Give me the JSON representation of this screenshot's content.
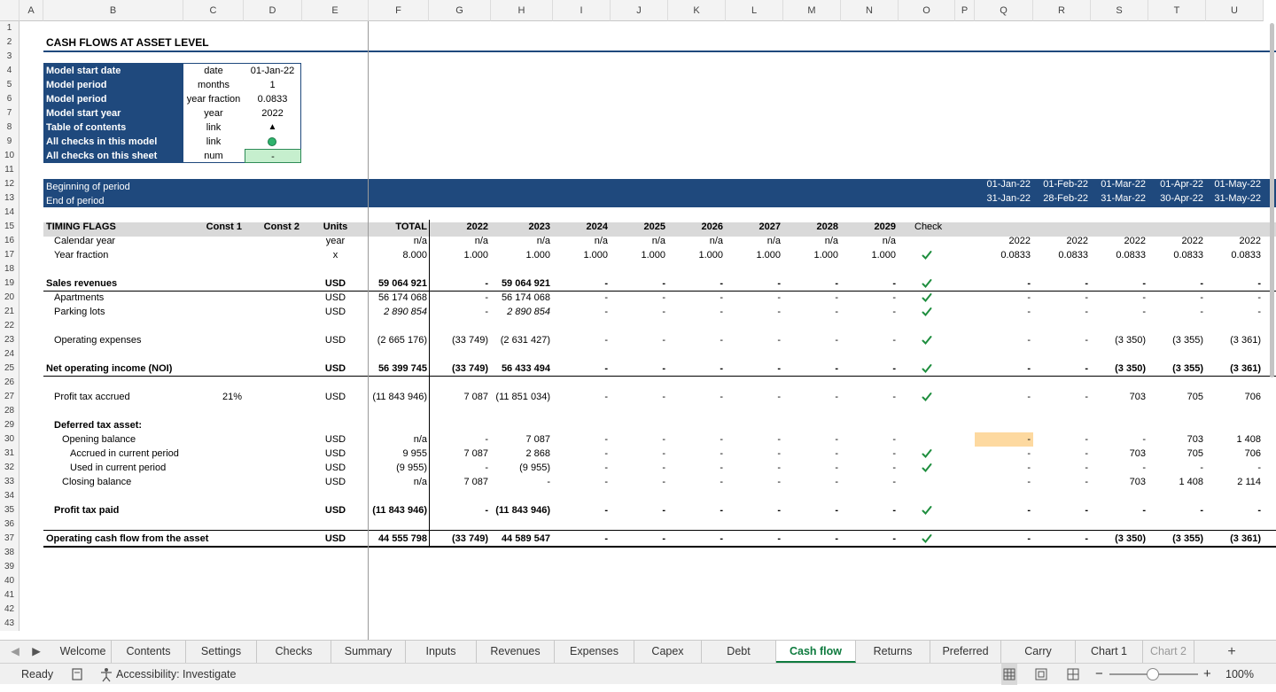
{
  "columns": [
    "A",
    "B",
    "C",
    "D",
    "E",
    "F",
    "G",
    "H",
    "I",
    "J",
    "K",
    "L",
    "M",
    "N",
    "O",
    "P",
    "Q",
    "R",
    "S",
    "T",
    "U"
  ],
  "rows": [
    "1",
    "2",
    "3",
    "4",
    "5",
    "6",
    "7",
    "8",
    "9",
    "10",
    "11",
    "12",
    "13",
    "14",
    "15",
    "16",
    "17",
    "18",
    "19",
    "20",
    "21",
    "22",
    "23",
    "24",
    "25",
    "26",
    "27",
    "28",
    "29",
    "30",
    "31",
    "32",
    "33",
    "34",
    "35",
    "36",
    "37",
    "38",
    "39",
    "40",
    "41",
    "42",
    "43"
  ],
  "title": "CASH FLOWS AT ASSET LEVEL",
  "info": [
    {
      "label": "Model start date",
      "unit": "date",
      "value": "01-Jan-22"
    },
    {
      "label": "Model period",
      "unit": "months",
      "value": "1"
    },
    {
      "label": "Model period",
      "unit": "year fraction",
      "value": "0.0833"
    },
    {
      "label": "Model start year",
      "unit": "year",
      "value": "2022"
    },
    {
      "label": "Table of contents",
      "unit": "link",
      "value": "▲"
    },
    {
      "label": "All checks in this model",
      "unit": "link",
      "value": ""
    },
    {
      "label": "All checks on this sheet",
      "unit": "num",
      "value": "-"
    }
  ],
  "period": {
    "begin_label": "Beginning of period",
    "end_label": "End of period",
    "begin": [
      "01-Jan-22",
      "01-Feb-22",
      "01-Mar-22",
      "01-Apr-22",
      "01-May-22"
    ],
    "end": [
      "31-Jan-22",
      "28-Feb-22",
      "31-Mar-22",
      "30-Apr-22",
      "31-May-22"
    ]
  },
  "header": {
    "label": "TIMING FLAGS",
    "const1": "Const 1",
    "const2": "Const 2",
    "units": "Units",
    "total": "TOTAL",
    "years": [
      "2022",
      "2023",
      "2024",
      "2025",
      "2026",
      "2027",
      "2028",
      "2029"
    ],
    "check": "Check"
  },
  "table_rows": [
    {
      "row": 16,
      "label": "Calendar year",
      "indent": 1,
      "const1": "",
      "unit": "year",
      "total": "n/a",
      "years": [
        "n/a",
        "n/a",
        "n/a",
        "n/a",
        "n/a",
        "n/a",
        "n/a",
        "n/a"
      ],
      "check": false,
      "monthly": [
        "2022",
        "2022",
        "2022",
        "2022",
        "2022"
      ]
    },
    {
      "row": 17,
      "label": "Year fraction",
      "indent": 1,
      "const1": "",
      "unit": "x",
      "total": "8.000",
      "years": [
        "1.000",
        "1.000",
        "1.000",
        "1.000",
        "1.000",
        "1.000",
        "1.000",
        "1.000"
      ],
      "check": true,
      "monthly": [
        "0.0833",
        "0.0833",
        "0.0833",
        "0.0833",
        "0.0833"
      ]
    },
    {
      "row": 19,
      "label": "Sales revenues",
      "indent": 0,
      "bold": true,
      "underline": true,
      "const1": "",
      "unit": "USD",
      "total": "59 064 921",
      "years": [
        "-",
        "59 064 921",
        "-",
        "-",
        "-",
        "-",
        "-",
        "-"
      ],
      "check": true,
      "monthly": [
        "-",
        "-",
        "-",
        "-",
        "-"
      ]
    },
    {
      "row": 20,
      "label": "Apartments",
      "indent": 1,
      "const1": "",
      "unit": "USD",
      "total": "56 174 068",
      "years": [
        "-",
        "56 174 068",
        "-",
        "-",
        "-",
        "-",
        "-",
        "-"
      ],
      "check": true,
      "monthly": [
        "-",
        "-",
        "-",
        "-",
        "-"
      ]
    },
    {
      "row": 21,
      "label": "Parking lots",
      "indent": 1,
      "italicvals": true,
      "const1": "",
      "unit": "USD",
      "total": "2 890 854",
      "years": [
        "-",
        "2 890 854",
        "-",
        "-",
        "-",
        "-",
        "-",
        "-"
      ],
      "check": true,
      "monthly": [
        "-",
        "-",
        "-",
        "-",
        "-"
      ]
    },
    {
      "row": 23,
      "label": "Operating expenses",
      "indent": 1,
      "const1": "",
      "unit": "USD",
      "total": "(2 665 176)",
      "years": [
        "(33 749)",
        "(2 631 427)",
        "-",
        "-",
        "-",
        "-",
        "-",
        "-"
      ],
      "check": true,
      "monthly": [
        "-",
        "-",
        "(3 350)",
        "(3 355)",
        "(3 361)"
      ]
    },
    {
      "row": 25,
      "label": "Net operating income (NOI)",
      "indent": 0,
      "bold": true,
      "underline": true,
      "const1": "",
      "unit": "USD",
      "total": "56 399 745",
      "years": [
        "(33 749)",
        "56 433 494",
        "-",
        "-",
        "-",
        "-",
        "-",
        "-"
      ],
      "check": true,
      "monthly": [
        "-",
        "-",
        "(3 350)",
        "(3 355)",
        "(3 361)"
      ]
    },
    {
      "row": 27,
      "label": "Profit tax accrued",
      "indent": 1,
      "const1": "21%",
      "unit": "USD",
      "total": "(11 843 946)",
      "years": [
        "7 087",
        "(11 851 034)",
        "-",
        "-",
        "-",
        "-",
        "-",
        "-"
      ],
      "check": true,
      "monthly": [
        "-",
        "-",
        "703",
        "705",
        "706"
      ]
    },
    {
      "row": 29,
      "label": "Deferred tax asset:",
      "indent": 1,
      "bold": true,
      "const1": "",
      "unit": "",
      "total": "",
      "years": [
        "",
        "",
        "",
        "",
        "",
        "",
        "",
        ""
      ],
      "check": false,
      "monthly": [
        "",
        "",
        "",
        "",
        ""
      ]
    },
    {
      "row": 30,
      "label": "Opening balance",
      "indent": 2,
      "const1": "",
      "unit": "USD",
      "total": "n/a",
      "years": [
        "-",
        "7 087",
        "-",
        "-",
        "-",
        "-",
        "-",
        "-"
      ],
      "check": false,
      "monthly": [
        "-",
        "-",
        "-",
        "703",
        "1 408"
      ]
    },
    {
      "row": 31,
      "label": "Accrued in current period",
      "indent": 3,
      "const1": "",
      "unit": "USD",
      "total": "9 955",
      "years": [
        "7 087",
        "2 868",
        "-",
        "-",
        "-",
        "-",
        "-",
        "-"
      ],
      "check": true,
      "monthly": [
        "-",
        "-",
        "703",
        "705",
        "706"
      ]
    },
    {
      "row": 32,
      "label": "Used in current period",
      "indent": 3,
      "const1": "",
      "unit": "USD",
      "total": "(9 955)",
      "years": [
        "-",
        "(9 955)",
        "-",
        "-",
        "-",
        "-",
        "-",
        "-"
      ],
      "check": true,
      "monthly": [
        "-",
        "-",
        "-",
        "-",
        "-"
      ]
    },
    {
      "row": 33,
      "label": "Closing balance",
      "indent": 2,
      "const1": "",
      "unit": "USD",
      "total": "n/a",
      "years": [
        "7 087",
        "-",
        "-",
        "-",
        "-",
        "-",
        "-",
        "-"
      ],
      "check": false,
      "monthly": [
        "-",
        "-",
        "703",
        "1 408",
        "2 114"
      ]
    },
    {
      "row": 35,
      "label": "Profit tax paid",
      "indent": 1,
      "bold": true,
      "const1": "",
      "unit": "USD",
      "total": "(11 843 946)",
      "years": [
        "-",
        "(11 843 946)",
        "-",
        "-",
        "-",
        "-",
        "-",
        "-"
      ],
      "check": true,
      "monthly": [
        "-",
        "-",
        "-",
        "-",
        "-"
      ]
    },
    {
      "row": 37,
      "label": "Operating cash flow from the asset",
      "indent": 0,
      "bold": true,
      "underline": true,
      "const1": "",
      "unit": "USD",
      "total": "44 555 798",
      "years": [
        "(33 749)",
        "44 589 547",
        "-",
        "-",
        "-",
        "-",
        "-",
        "-"
      ],
      "check": true,
      "monthly": [
        "-",
        "-",
        "(3 350)",
        "(3 355)",
        "(3 361)"
      ]
    }
  ],
  "tabs": [
    "Welcome",
    "Contents",
    "Settings",
    "Checks",
    "Summary",
    "Inputs",
    "Revenues",
    "Expenses",
    "Capex",
    "Debt",
    "Cash flow",
    "Returns",
    "Preferred",
    "Carry",
    "Chart 1",
    "Chart 2"
  ],
  "active_tab": "Cash flow",
  "status": {
    "ready": "Ready",
    "accessibility": "Accessibility: Investigate",
    "zoom": "100%"
  },
  "colors": {
    "navy": "#1f497d",
    "green": "#0f7b3f",
    "check": "#1e8e3e",
    "highlight": "#fdd9a0",
    "checkcell": "#c6efce"
  }
}
